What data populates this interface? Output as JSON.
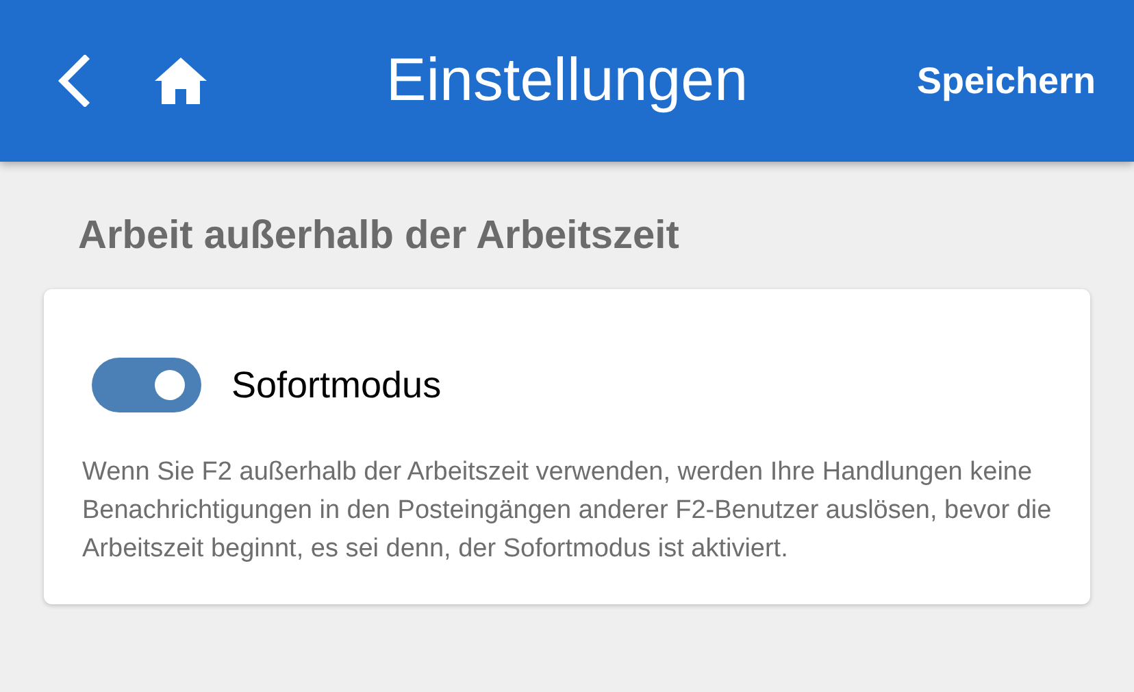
{
  "header": {
    "title": "Einstellungen",
    "save_label": "Speichern"
  },
  "section": {
    "title": "Arbeit außerhalb der Arbeitszeit"
  },
  "setting": {
    "label": "Sofortmodus",
    "on": true,
    "description": "Wenn Sie F2 außerhalb der Arbeitszeit verwenden, werden Ihre Handlungen keine Benachrichtigungen in den Posteingängen anderer F2-Benutzer auslösen, bevor die Arbeitszeit beginnt, es sei denn, der Sofortmodus ist aktiviert."
  }
}
